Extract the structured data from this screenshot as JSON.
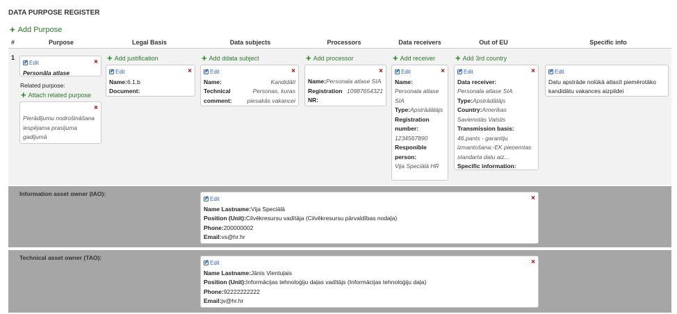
{
  "page": {
    "title": "DATA PURPOSE REGISTER",
    "add_purpose": "Add Purpose"
  },
  "columns": {
    "hash": "#",
    "purpose": "Purpose",
    "legal_basis": "Legal Basis",
    "data_subjects": "Data subjects",
    "processors": "Processors",
    "data_receivers": "Data receivers",
    "out_of_eu": "Out of EU",
    "specific_info": "Specific info"
  },
  "row": {
    "number": "1",
    "edit_label": "Edit",
    "close_glyph": "×",
    "purpose": {
      "name": "Personāla atlase",
      "related_label": "Related purpose:",
      "attach_label": "Attach related purpose",
      "related_text": "Pierādījumu nodrošināšana iespējama prasījuma gadījumā"
    },
    "legal_basis": {
      "add_label": "Add justification",
      "name_label": "Name:",
      "name_value": "6.1.b",
      "document_label": "Document:"
    },
    "data_subjects": {
      "add_label": "Add ddata subject",
      "name_label": "Name:",
      "name_value": "Kandidāti",
      "tech_label": "Technical comment:",
      "tech_value": "Personas, kuras piesakās vakancei"
    },
    "processors": {
      "add_label": "Add processor",
      "name_label": "Name:",
      "name_value": "Personala atlase SIA",
      "reg_label": "Registration NR:",
      "reg_value": "10987654321"
    },
    "data_receivers": {
      "add_label": "Add receiver",
      "name_label": "Name:",
      "name_value": "Personala atlase SIA",
      "type_label": "Type:",
      "type_value": "Apstrādātājs",
      "reg_label": "Registration number:",
      "reg_value": "1234567890",
      "resp_label": "Responible person:",
      "resp_value": "Vija Speciālā HR"
    },
    "out_of_eu": {
      "add_label": "Add 3rd country",
      "receiver_label": "Data receiver:",
      "receiver_value": "Personala atlase SIA",
      "type_label": "Type:",
      "type_value": "Apstrādātājs",
      "country_label": "Country:",
      "country_value": "Amerikas Savienotās Valstis",
      "basis_label": "Transmission basis:",
      "basis_value": "46.pants - garantiju izmantošana:-EK pieņemtas standarta datu aiz...",
      "specific_label": "Specific information:"
    },
    "specific_info": {
      "text": "Datu apstrāde nolūkā atlasīt piemērotāko kandidātu vakances aizpildei"
    }
  },
  "iao": {
    "section_label": "Information asset owner (IAO):",
    "name_label": "Name Lastname:",
    "name_value": "Vija Speciālā",
    "position_label": "Position (Unit):",
    "position_value": "Cilvēkresursu vadītāja (Cilvēkresursu pārvaldības nodaļa)",
    "phone_label": "Phone:",
    "phone_value": "200000002",
    "email_label": "Email:",
    "email_value": "vs@hr.hr"
  },
  "tao": {
    "section_label": "Technical asset owner (TAO):",
    "name_label": "Name Lastname:",
    "name_value": "Jānis Vientuļais",
    "position_label": "Position (Unit):",
    "position_value": "Informācijas tehnoloģiju daļas vadītājs (Informācijas tehnoloģiju daļa)",
    "phone_label": "Phone:",
    "phone_value": "92222222222",
    "email_label": "Email:",
    "email_value": "jv@hr.hr"
  },
  "colors": {
    "accent_green": "#1d8a1d",
    "link_blue": "#3366cc",
    "close_red": "#a00000",
    "section_gray": "#a6a6a6"
  }
}
